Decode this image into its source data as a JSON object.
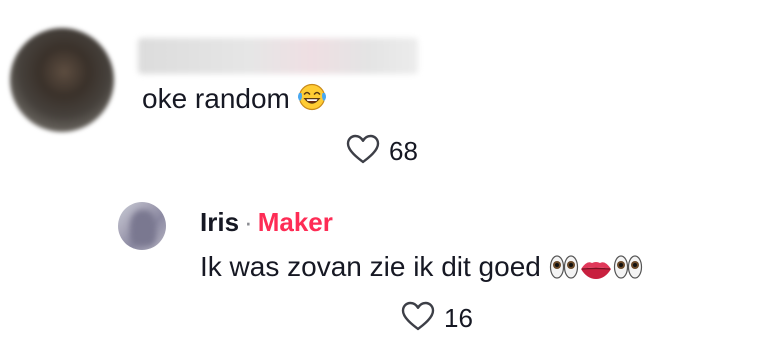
{
  "comment": {
    "text": "oke random",
    "emoji": "face-with-tears-of-joy",
    "likes": "68"
  },
  "reply": {
    "username": "Iris",
    "separator": "·",
    "role": "Maker",
    "text": "Ik was zovan zie ik dit goed",
    "emojis": [
      "eyes",
      "lips",
      "eyes"
    ],
    "likes": "16"
  },
  "colors": {
    "text": "#161823",
    "accent": "#fe2c55",
    "muted": "#8a8b91"
  }
}
